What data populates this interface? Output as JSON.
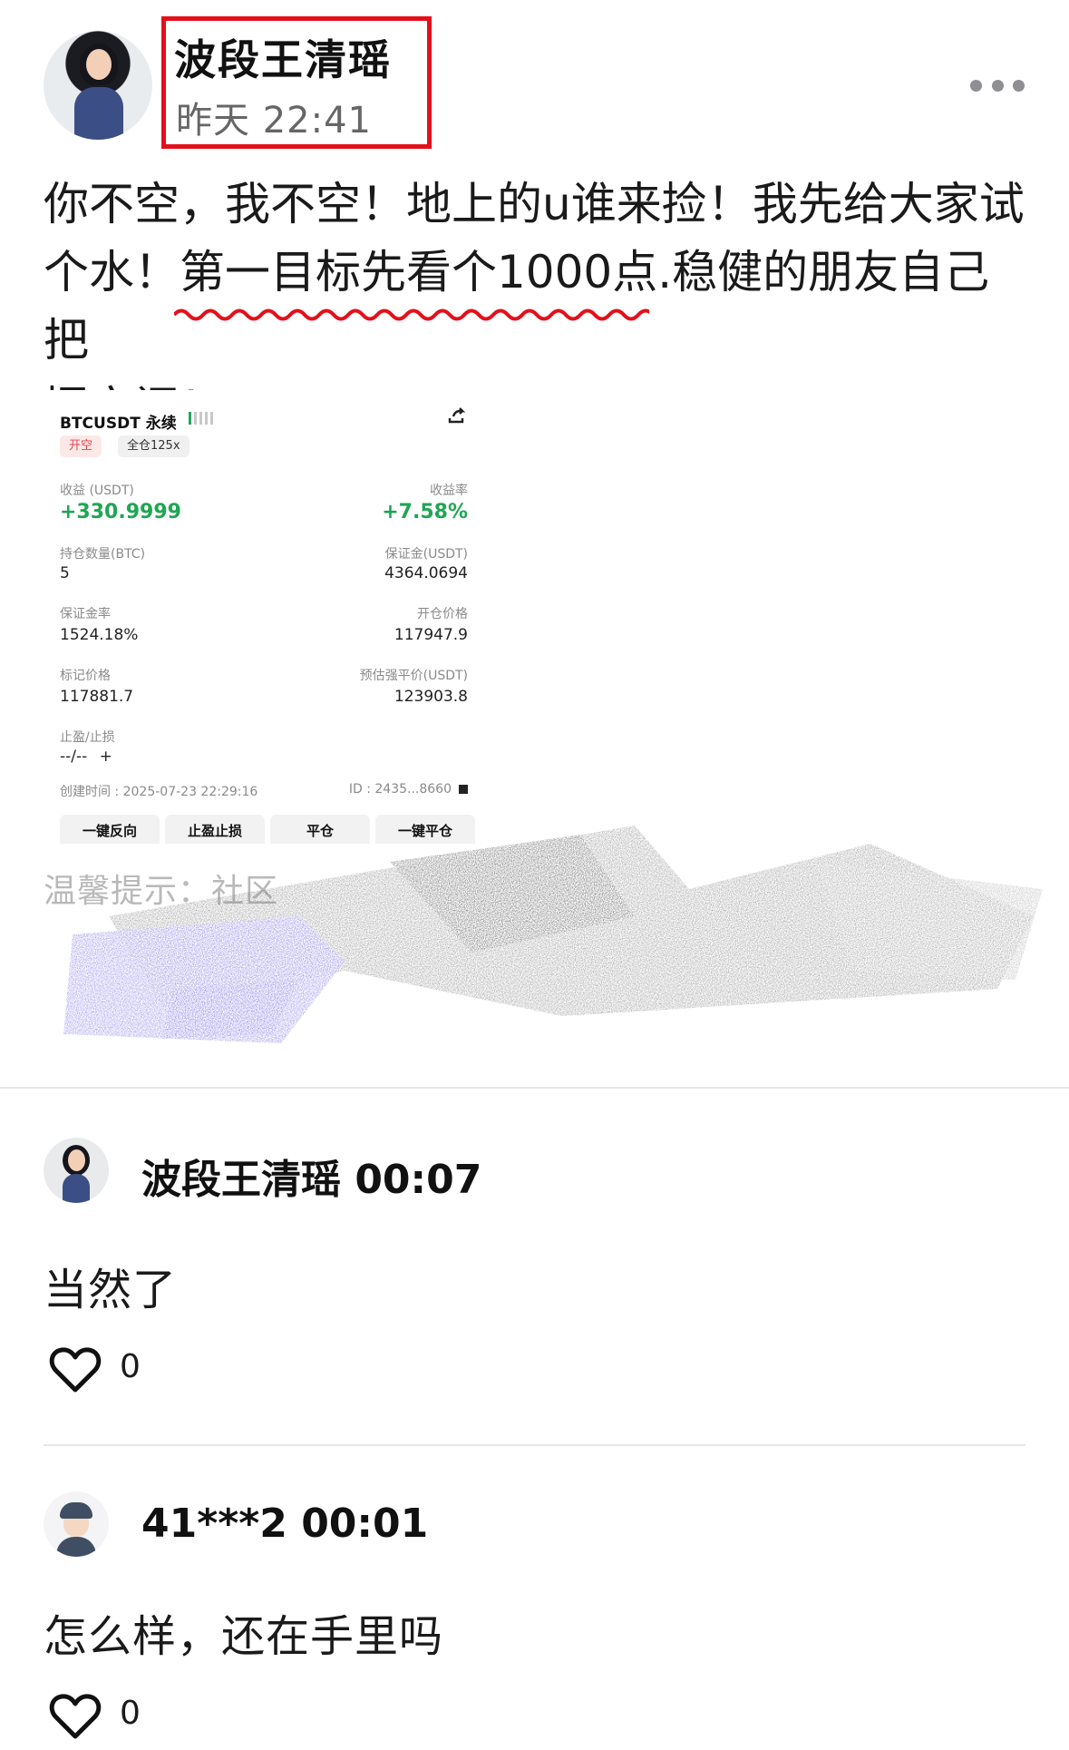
{
  "post": {
    "author": "波段王清瑶",
    "time": "昨天 22:41",
    "text_line1": "你不空，我不空！地上的u谁来捡！我先给大家试",
    "text_line2": "个水！第一目标先看个1000点.稳健的朋友自己把",
    "text_line3": "握空间！"
  },
  "trade_card": {
    "symbol": "BTCUSDT 永续",
    "side_tag": "开空",
    "leverage_tag": "全仓125x",
    "pnl_label": "收益 (USDT)",
    "pnl_value": "+330.9999",
    "roe_label": "收益率",
    "roe_value": "+7.58%",
    "size_label": "持仓数量(BTC)",
    "size_value": "5",
    "margin_label": "保证金(USDT)",
    "margin_value": "4364.0694",
    "margin_ratio_label": "保证金率",
    "margin_ratio_value": "1524.18%",
    "entry_label": "开仓价格",
    "entry_value": "117947.9",
    "mark_label": "标记价格",
    "mark_value": "117881.7",
    "liq_label": "预估强平价(USDT)",
    "liq_value": "123903.8",
    "tpsl_label": "止盈/止损",
    "tpsl_value": "--/--",
    "tpsl_add": "+",
    "created_label": "创建时间 : 2025-07-23 22:29:16",
    "id_label": "ID : 2435...8660",
    "buttons": [
      "一键反向",
      "止盈止损",
      "平仓",
      "一键平仓"
    ],
    "green": "#1fa653",
    "red": "#e0474b"
  },
  "hint": {
    "text": "温馨提示：社区"
  },
  "comments": [
    {
      "name": "波段王清瑶 00:07",
      "text": "当然了",
      "likes": "0",
      "avatar": "woman-avatar"
    },
    {
      "name": "41***2 00:01",
      "text": "怎么样，还在手里吗",
      "likes": "0",
      "avatar": "man-avatar"
    }
  ],
  "colors": {
    "highlight_box": "#e3101b",
    "wavy_underline": "#e3101b",
    "scribble_purple": "#7d6ee8"
  }
}
